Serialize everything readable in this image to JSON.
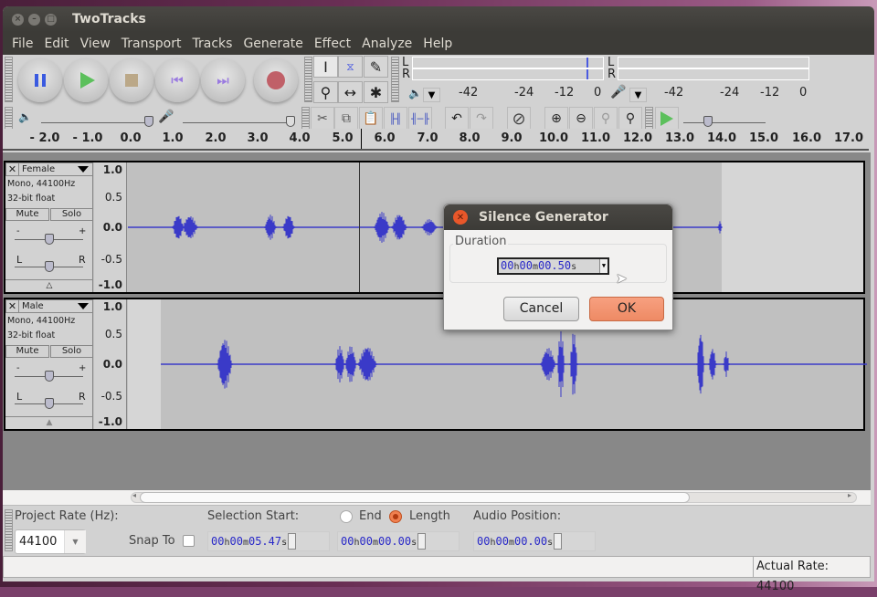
{
  "window": {
    "title": "TwoTracks"
  },
  "menu": [
    "File",
    "Edit",
    "View",
    "Transport",
    "Tracks",
    "Generate",
    "Effect",
    "Analyze",
    "Help"
  ],
  "transport": {
    "buttons": [
      "pause",
      "play",
      "stop",
      "skip-to-start",
      "skip-to-end",
      "record"
    ]
  },
  "tools": [
    "selection-tool",
    "envelope-tool",
    "draw-tool",
    "zoom-tool",
    "time-shift-tool",
    "multi-tool"
  ],
  "meters": {
    "playback": {
      "channels": [
        "L",
        "R"
      ],
      "scale": [
        "-42",
        "-24",
        "-12",
        "0"
      ]
    },
    "record": {
      "channels": [
        "L",
        "R"
      ],
      "scale": [
        "-42",
        "-24",
        "-12",
        "0"
      ]
    }
  },
  "mixer": {
    "playback_volume": 0.97,
    "record_volume": 1.0
  },
  "play_speed": 0.3,
  "ruler": {
    "ticks": [
      "- 2.0",
      "- 1.0",
      "0.0",
      "1.0",
      "2.0",
      "3.0",
      "4.0",
      "5.0",
      "6.0",
      "7.0",
      "8.0",
      "9.0",
      "10.0",
      "11.0",
      "12.0",
      "13.0",
      "14.0",
      "15.0",
      "16.0",
      "17.0"
    ]
  },
  "tracks": [
    {
      "name": "Female",
      "format": "Mono, 44100Hz",
      "bits": "32-bit float",
      "mute": "Mute",
      "solo": "Solo",
      "gain_label_min": "-",
      "gain_label_max": "+",
      "pan_left": "L",
      "pan_right": "R",
      "gain": 0.5,
      "pan": 0.5,
      "vscale": [
        "1.0",
        "0.5",
        "0.0",
        "-0.5",
        "-1.0"
      ]
    },
    {
      "name": "Male",
      "format": "Mono, 44100Hz",
      "bits": "32-bit float",
      "mute": "Mute",
      "solo": "Solo",
      "gain_label_min": "-",
      "gain_label_max": "+",
      "pan_left": "L",
      "pan_right": "R",
      "gain": 0.5,
      "pan": 0.5,
      "vscale": [
        "1.0",
        "0.5",
        "0.0",
        "-0.5",
        "-1.0"
      ]
    }
  ],
  "dialog": {
    "title": "Silence Generator",
    "group_label": "Duration",
    "duration": {
      "h": "00",
      "h_unit": "h",
      "m": "00",
      "m_unit": "m",
      "s": "00.50",
      "s_unit": "s"
    },
    "cancel": "Cancel",
    "ok": "OK"
  },
  "selection_bar": {
    "project_rate_label": "Project Rate (Hz):",
    "project_rate": "44100",
    "snap_to_label": "Snap To",
    "selection_start_label": "Selection Start:",
    "end_label": "End",
    "length_label": "Length",
    "length_selected": true,
    "audio_position_label": "Audio Position:",
    "selection_start": {
      "h": "00",
      "h_unit": "h",
      "m": "00",
      "m_unit": "m",
      "s": "05.47",
      "s_unit": "s"
    },
    "length": {
      "h": "00",
      "h_unit": "h",
      "m": "00",
      "m_unit": "m",
      "s": "00.00",
      "s_unit": "s"
    },
    "audio_position": {
      "h": "00",
      "h_unit": "h",
      "m": "00",
      "m_unit": "m",
      "s": "00.00",
      "s_unit": "s"
    }
  },
  "status": {
    "actual_rate": "Actual Rate: 44100"
  }
}
